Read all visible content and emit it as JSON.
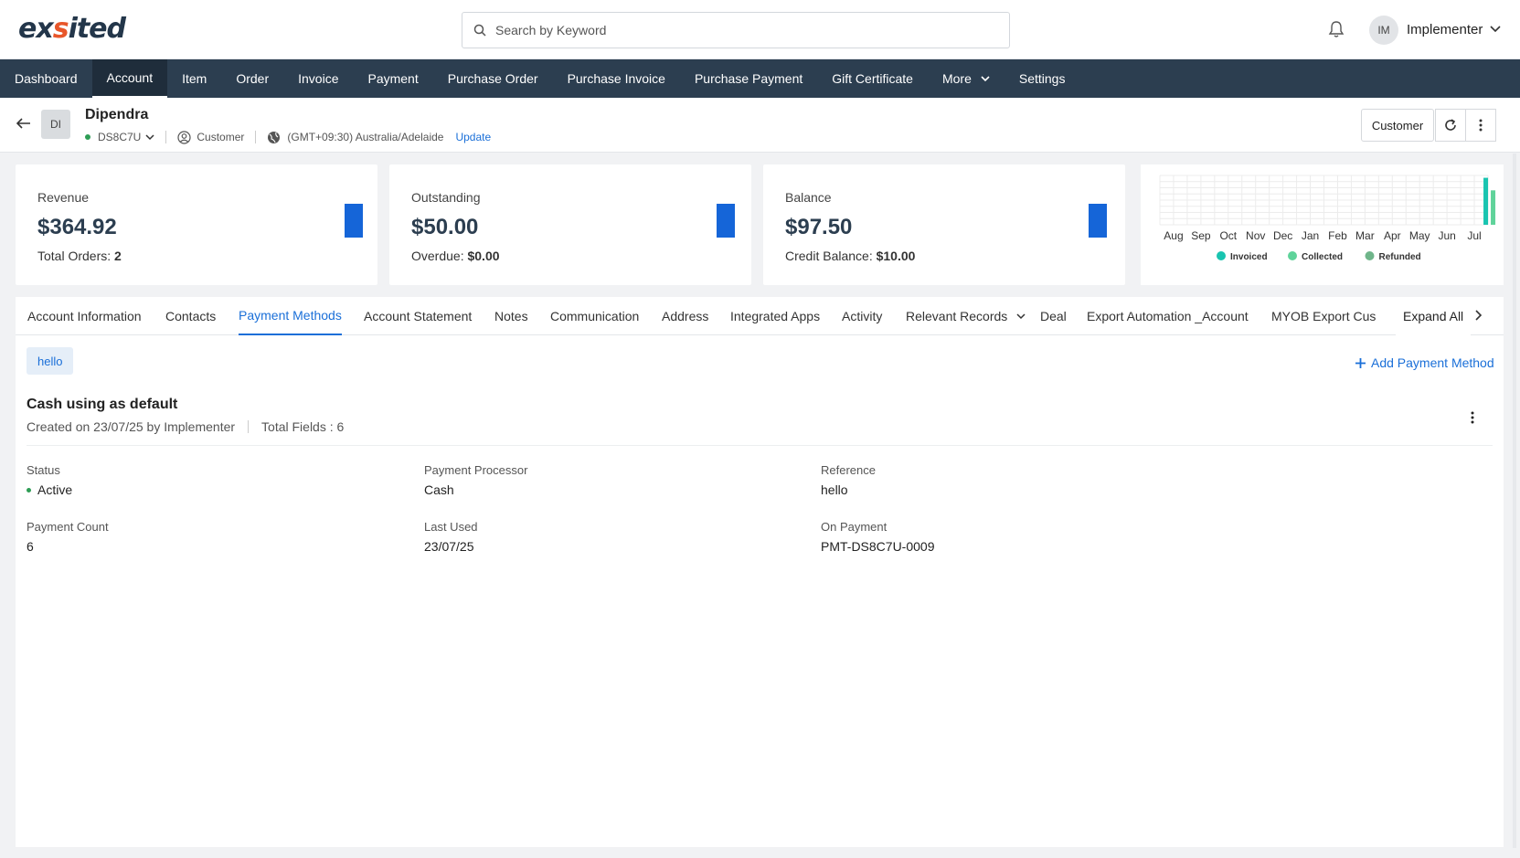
{
  "header": {
    "logo": "exsited",
    "search_placeholder": "Search by Keyword",
    "user_initials": "IM",
    "user_name": "Implementer"
  },
  "nav": {
    "items": [
      {
        "label": "Dashboard"
      },
      {
        "label": "Account",
        "active": true
      },
      {
        "label": "Item"
      },
      {
        "label": "Order"
      },
      {
        "label": "Invoice"
      },
      {
        "label": "Payment"
      },
      {
        "label": "Purchase Order"
      },
      {
        "label": "Purchase Invoice"
      },
      {
        "label": "Purchase Payment"
      },
      {
        "label": "Gift Certificate"
      },
      {
        "label": "More"
      },
      {
        "label": "Settings"
      }
    ]
  },
  "account": {
    "initials": "DI",
    "name": "Dipendra",
    "code": "DS8C7U",
    "type": "Customer",
    "timezone": "(GMT+09:30) Australia/Adelaide",
    "update_label": "Update",
    "customer_button": "Customer"
  },
  "cards": {
    "revenue": {
      "label": "Revenue",
      "value": "$364.92",
      "sub_label": "Total Orders:",
      "sub_value": "2"
    },
    "outstanding": {
      "label": "Outstanding",
      "value": "$50.00",
      "sub_label": "Overdue:",
      "sub_value": "$0.00"
    },
    "balance": {
      "label": "Balance",
      "value": "$97.50",
      "sub_label": "Credit Balance:",
      "sub_value": "$10.00"
    }
  },
  "chart_data": {
    "type": "bar",
    "categories": [
      "Aug",
      "Sep",
      "Oct",
      "Nov",
      "Dec",
      "Jan",
      "Feb",
      "Mar",
      "Apr",
      "May",
      "Jun",
      "Jul"
    ],
    "series": [
      {
        "name": "Invoiced",
        "color": "#19c4b0",
        "values": [
          0,
          0,
          0,
          0,
          0,
          0,
          0,
          0,
          0,
          0,
          0,
          364.92
        ]
      },
      {
        "name": "Collected",
        "color": "#5fd39a",
        "values": [
          0,
          0,
          0,
          0,
          0,
          0,
          0,
          0,
          0,
          0,
          0,
          267.42
        ]
      },
      {
        "name": "Refunded",
        "color": "#6fb58a",
        "values": [
          0,
          0,
          0,
          0,
          0,
          0,
          0,
          0,
          0,
          0,
          0,
          0
        ]
      }
    ],
    "title": "",
    "grid": true,
    "legend": "bottom"
  },
  "tabs": {
    "items": [
      {
        "label": "Account Information"
      },
      {
        "label": "Contacts"
      },
      {
        "label": "Payment Methods",
        "active": true
      },
      {
        "label": "Account Statement"
      },
      {
        "label": "Notes"
      },
      {
        "label": "Communication"
      },
      {
        "label": "Address"
      },
      {
        "label": "Integrated Apps"
      },
      {
        "label": "Activity"
      },
      {
        "label": "Relevant Records"
      },
      {
        "label": "Deal"
      },
      {
        "label": "Export Automation _Account"
      },
      {
        "label": "MYOB Export Cus"
      }
    ],
    "expand_all": "Expand All"
  },
  "payment_methods": {
    "chip": "hello",
    "add_label": "Add Payment Method",
    "title": "Cash using as default",
    "created": "Created on 23/07/25 by Implementer",
    "total_fields": "Total Fields : 6",
    "fields": {
      "status": {
        "label": "Status",
        "value": "Active"
      },
      "processor": {
        "label": "Payment Processor",
        "value": "Cash"
      },
      "reference": {
        "label": "Reference",
        "value": "hello"
      },
      "count": {
        "label": "Payment Count",
        "value": "6"
      },
      "last_used": {
        "label": "Last Used",
        "value": "23/07/25"
      },
      "on_payment": {
        "label": "On Payment",
        "value": "PMT-DS8C7U-0009"
      }
    }
  },
  "colors": {
    "nav_bg": "#2c3e50",
    "accent": "#1a6fd8",
    "kpi_bar": "#1565d8",
    "status_active": "#2e9d55"
  }
}
